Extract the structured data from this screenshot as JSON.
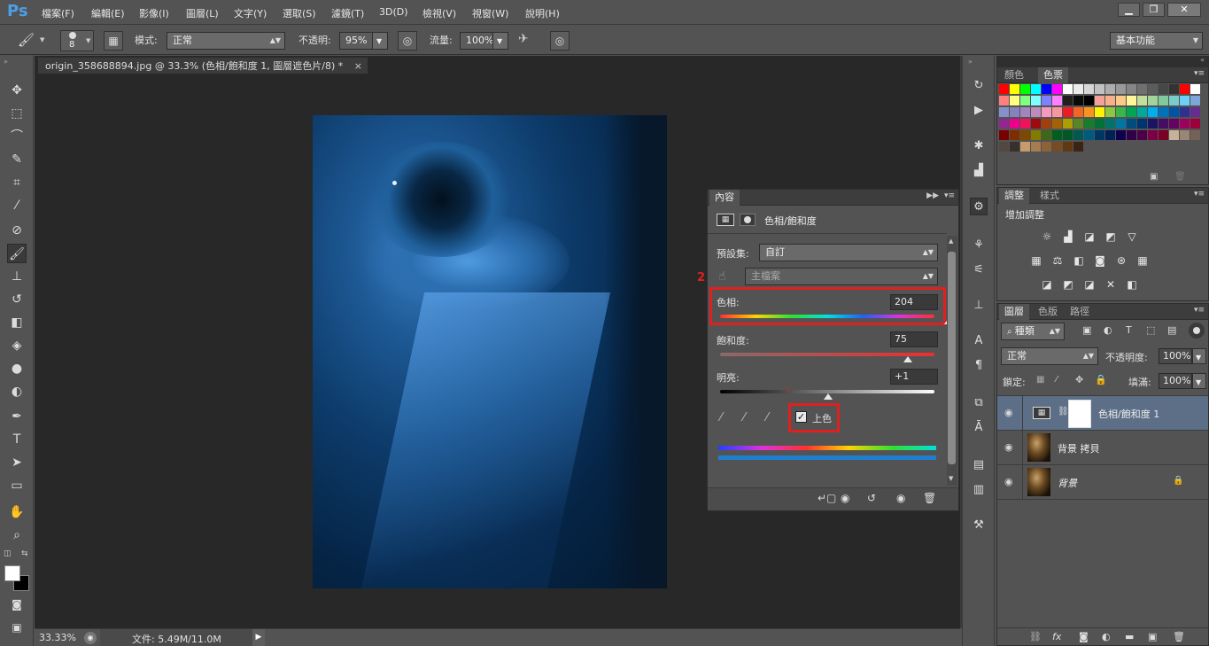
{
  "app": {
    "logo": "Ps",
    "menu": [
      "檔案(F)",
      "編輯(E)",
      "影像(I)",
      "圖層(L)",
      "文字(Y)",
      "選取(S)",
      "濾鏡(T)",
      "3D(D)",
      "檢視(V)",
      "視窗(W)",
      "說明(H)"
    ],
    "window_buttons": [
      "▁",
      "❐",
      "✕"
    ]
  },
  "options": {
    "brush_size": "8",
    "mode_label": "模式:",
    "mode_value": "正常",
    "opacity_label": "不透明:",
    "opacity_value": "95%",
    "flow_label": "流量:",
    "flow_value": "100%",
    "workspace": "基本功能"
  },
  "document": {
    "tab_title": "origin_358688894.jpg @ 33.3% (色相/飽和度 1, 圖層遮色片/8) *",
    "close": "×",
    "zoom": "33.33%",
    "file_info": "文件: 5.49M/11.0M"
  },
  "properties": {
    "tab": "內容",
    "title": "色相/飽和度",
    "preset_label": "預設集:",
    "preset_value": "自訂",
    "channel_value": "主檔案",
    "annotation_number": "2",
    "hue_label": "色相:",
    "hue_value": "204",
    "hue": 204,
    "saturation_label": "飽和度:",
    "saturation_value": "75",
    "saturation": 75,
    "lightness_label": "明亮:",
    "lightness_value": "+1",
    "lightness": 1,
    "colorize_label": "上色",
    "colorize_checked": true
  },
  "color_panel": {
    "tabs": [
      "顏色",
      "色票"
    ]
  },
  "adjust_panel": {
    "tabs": [
      "調整",
      "樣式"
    ],
    "title": "增加調整"
  },
  "layers_panel": {
    "tabs": [
      "圖層",
      "色版",
      "路徑"
    ],
    "filter_kind": "種類",
    "blend_mode": "正常",
    "opacity_label": "不透明度:",
    "opacity_value": "100%",
    "lock_label": "鎖定:",
    "fill_label": "填滿:",
    "fill_value": "100%",
    "layers": [
      {
        "name": "色相/飽和度 1",
        "type": "adjustment",
        "selected": true
      },
      {
        "name": "背景 拷貝",
        "type": "image",
        "selected": false
      },
      {
        "name": "背景",
        "type": "image",
        "locked": true,
        "selected": false
      }
    ]
  },
  "colors": {
    "accent_red": "#e02020",
    "selected_layer": "#5c6f86",
    "canvas_blue": "#1e5a96"
  }
}
